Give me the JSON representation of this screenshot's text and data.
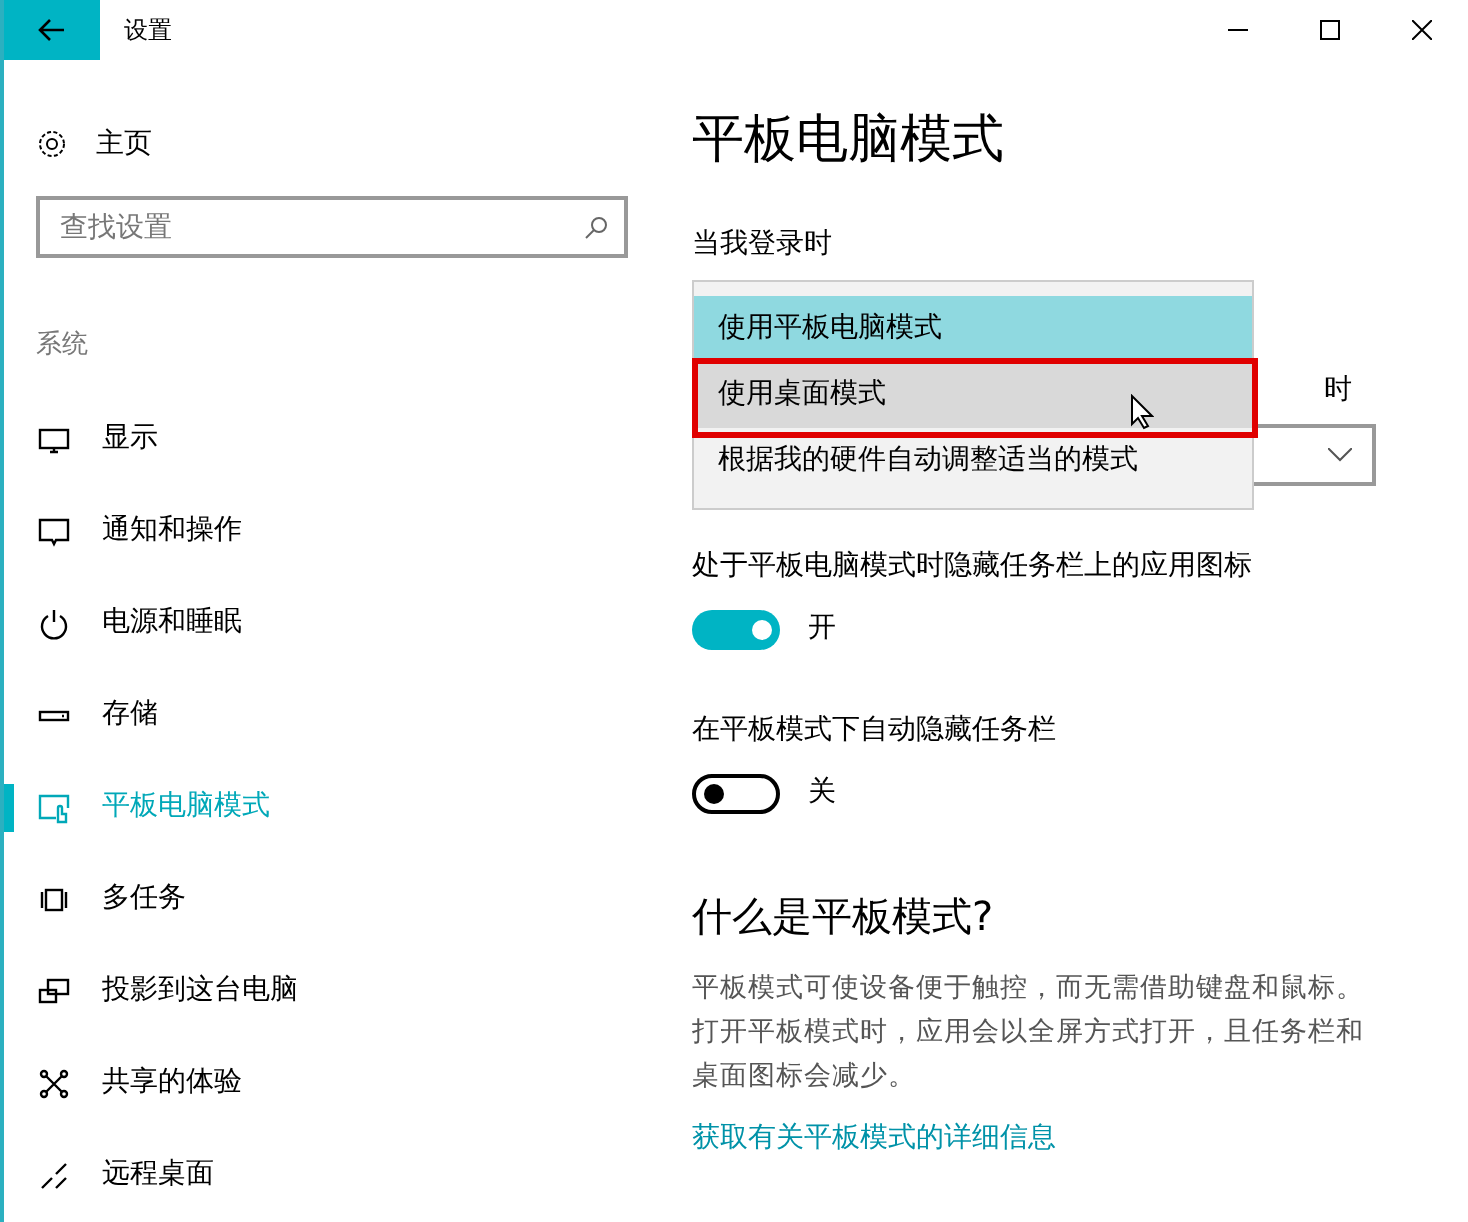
{
  "window": {
    "title": "设置"
  },
  "sidebar": {
    "home": "主页",
    "search": {
      "placeholder": "查找设置"
    },
    "section": "系统",
    "items": [
      {
        "kind": "display",
        "label": "显示",
        "selected": false
      },
      {
        "kind": "notify",
        "label": "通知和操作",
        "selected": false
      },
      {
        "kind": "power",
        "label": "电源和睡眠",
        "selected": false
      },
      {
        "kind": "storage",
        "label": "存储",
        "selected": false
      },
      {
        "kind": "tablet",
        "label": "平板电脑模式",
        "selected": true
      },
      {
        "kind": "multitask",
        "label": "多任务",
        "selected": false
      },
      {
        "kind": "project",
        "label": "投影到这台电脑",
        "selected": false
      },
      {
        "kind": "share",
        "label": "共享的体验",
        "selected": false
      },
      {
        "kind": "remote",
        "label": "远程桌面",
        "selected": false
      }
    ]
  },
  "content": {
    "title": "平板电脑模式",
    "signin_label": "当我登录时",
    "dropdown_options": [
      {
        "label": "使用平板电脑模式",
        "selected": true,
        "hovered": false,
        "highlighted": false
      },
      {
        "label": "使用桌面模式",
        "selected": false,
        "hovered": true,
        "highlighted": true
      },
      {
        "label": "根据我的硬件自动调整适当的模式",
        "selected": false,
        "hovered": false,
        "highlighted": false
      }
    ],
    "second_label_fragment": "时",
    "toggles": [
      {
        "label": "处于平板电脑模式时隐藏任务栏上的应用图标",
        "on": true,
        "state_text": "开"
      },
      {
        "label": "在平板模式下自动隐藏任务栏",
        "on": false,
        "state_text": "关"
      }
    ],
    "info_title": "什么是平板模式?",
    "info_text": "平板模式可使设备便于触控，而无需借助键盘和鼠标。打开平板模式时，应用会以全屏方式打开，且任务栏和桌面图标会减少。",
    "info_link": "获取有关平板模式的详细信息"
  }
}
